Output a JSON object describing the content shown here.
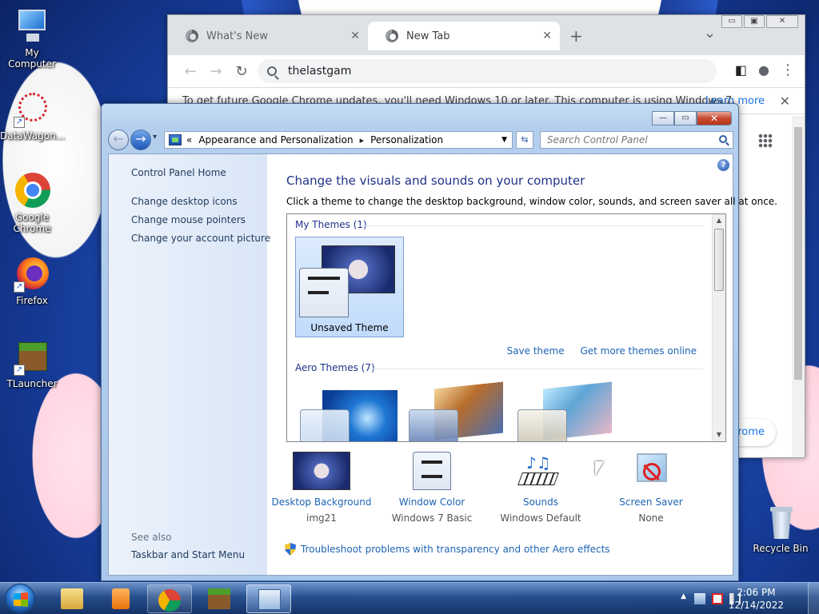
{
  "desktop": {
    "icons": [
      {
        "label": "My Computer",
        "icon": "computer-icon"
      },
      {
        "label": "DataWagon...",
        "icon": "datawagon-icon"
      },
      {
        "label": "Google Chrome",
        "icon": "chrome-icon"
      },
      {
        "label": "Firefox",
        "icon": "firefox-icon"
      },
      {
        "label": "TLauncher",
        "icon": "tlauncher-icon"
      },
      {
        "label": "Recycle Bin",
        "icon": "recycle-bin-icon"
      }
    ],
    "shortcut_glyph": "↗"
  },
  "chrome": {
    "tabs": [
      {
        "label": "What's New",
        "close": "✕"
      },
      {
        "label": "New Tab",
        "close": "✕"
      }
    ],
    "new_tab": "+",
    "tab_menu": "⌄",
    "caption": {
      "minimize": "▭",
      "maximize": "▣",
      "close": "✕"
    },
    "nav": {
      "back": "←",
      "forward": "→",
      "reload": "↻"
    },
    "omnibox_value": "thelastgam",
    "toolbar_icons": {
      "side_panel": "◧",
      "profile": "●",
      "menu": "⋮"
    },
    "infobar": {
      "message": "To get future Google Chrome updates, you'll need Windows 10 or later. This computer is using Windows 7.",
      "link": "Learn more",
      "close": "✕"
    },
    "page_pill": "rome"
  },
  "control_panel": {
    "caption": {
      "minimize": "—",
      "maximize": "▭",
      "close": "✕"
    },
    "nav": {
      "back": "←",
      "forward": "→",
      "history": "▾"
    },
    "breadcrumb": {
      "overflow": "«",
      "items": [
        "Appearance and Personalization",
        "Personalization"
      ],
      "separator": "▸",
      "dropdown": "▼"
    },
    "refresh": "⇆",
    "search_placeholder": "Search Control Panel",
    "left_pane": {
      "home": "Control Panel Home",
      "links": [
        "Change desktop icons",
        "Change mouse pointers",
        "Change your account picture"
      ],
      "see_also_heading": "See also",
      "see_also_links": [
        "Taskbar and Start Menu"
      ]
    },
    "help": "?",
    "title": "Change the visuals and sounds on your computer",
    "subtitle": "Click a theme to change the desktop background, window color, sounds, and screen saver all at once.",
    "themes": {
      "my_themes_heading": "My Themes (1)",
      "selected_theme": "Unsaved Theme",
      "save_theme": "Save theme",
      "get_more": "Get more themes online",
      "aero_heading": "Aero Themes (7)",
      "scroll_up": "▲",
      "scroll_down": "▼"
    },
    "settings": [
      {
        "label": "Desktop Background",
        "value": "img21",
        "icon": "desktop-background-icon"
      },
      {
        "label": "Window Color",
        "value": "Windows 7 Basic",
        "icon": "window-color-icon"
      },
      {
        "label": "Sounds",
        "value": "Windows Default",
        "icon": "sounds-icon"
      },
      {
        "label": "Screen Saver",
        "value": "None",
        "icon": "screen-saver-icon"
      }
    ],
    "troubleshoot": "Troubleshoot problems with transparency and other Aero effects"
  },
  "taskbar": {
    "tray_arrow": "▲",
    "time": "2:06 PM",
    "date": "12/14/2022"
  }
}
